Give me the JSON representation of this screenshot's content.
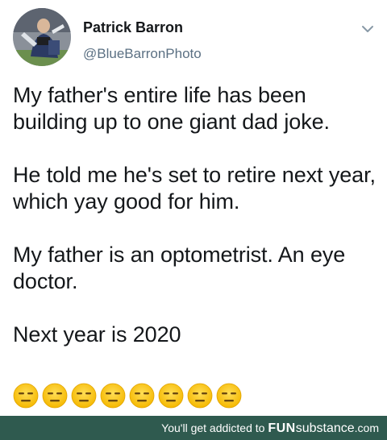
{
  "tweet": {
    "author": {
      "display_name": "Patrick Barron",
      "handle": "@BlueBarronPhoto"
    },
    "paragraphs": [
      "My father's entire life has been building up to one giant dad joke.",
      "He told me he's set to retire next year, which yay good for him.",
      "My father is an optometrist. An eye doctor.",
      "Next year is 2020"
    ],
    "emoji": {
      "name": "expressionless-face-icon",
      "count": 8
    }
  },
  "watermark": {
    "prefix": "You'll get addicted to",
    "brand_bold": "FUN",
    "brand_regular": "substance",
    "brand_tld": ".com",
    "background": "#2f5a4f"
  }
}
